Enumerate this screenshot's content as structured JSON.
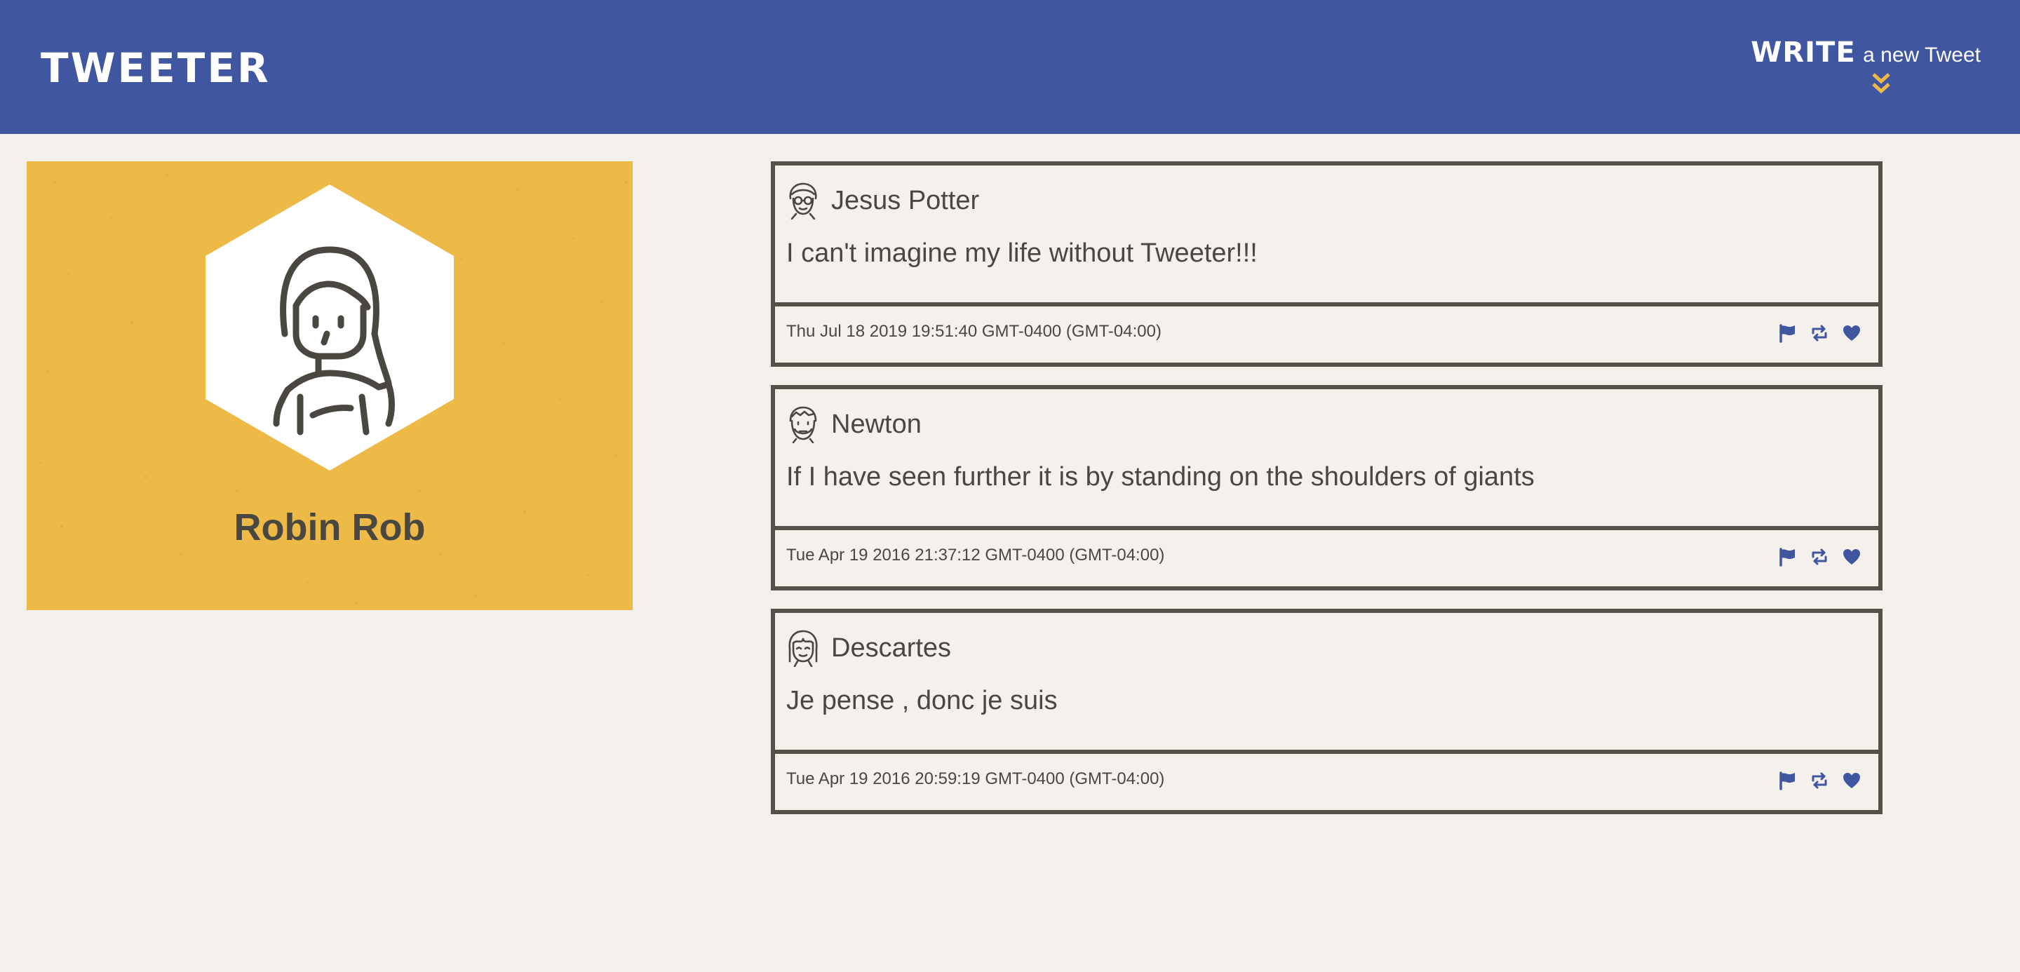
{
  "nav": {
    "brand": "TWEETER",
    "compose_strong": "WRITE",
    "compose_rest": "a new Tweet",
    "compose_icon": "double-chevron-down-icon"
  },
  "profile": {
    "name": "Robin Rob",
    "avatar_icon": "woman-avatar-icon"
  },
  "colors": {
    "nav_bg": "#4056a1",
    "page_bg": "#f4f1ec",
    "profile_bg": "#eeba47",
    "accent_yellow": "#eeba47",
    "text_dark": "#4a4741",
    "border_dark": "#545149",
    "action_icon_blue": "#4056a1"
  },
  "tweets": [
    {
      "author": "Jesus Potter",
      "avatar_icon": "man-with-glasses-avatar-icon",
      "content": "I can't imagine my life without Tweeter!!!",
      "timestamp": "Thu Jul 18 2019 19:51:40 GMT-0400 (GMT-04:00)",
      "actions": [
        "flag-icon",
        "retweet-icon",
        "heart-icon"
      ]
    },
    {
      "author": "Newton",
      "avatar_icon": "man-avatar-icon",
      "content": "If I have seen further it is by standing on the shoulders of giants",
      "timestamp": "Tue Apr 19 2016 21:37:12 GMT-0400 (GMT-04:00)",
      "actions": [
        "flag-icon",
        "retweet-icon",
        "heart-icon"
      ]
    },
    {
      "author": "Descartes",
      "avatar_icon": "woman-bangs-avatar-icon",
      "content": "Je pense , donc je suis",
      "timestamp": "Tue Apr 19 2016 20:59:19 GMT-0400 (GMT-04:00)",
      "actions": [
        "flag-icon",
        "retweet-icon",
        "heart-icon"
      ]
    }
  ]
}
